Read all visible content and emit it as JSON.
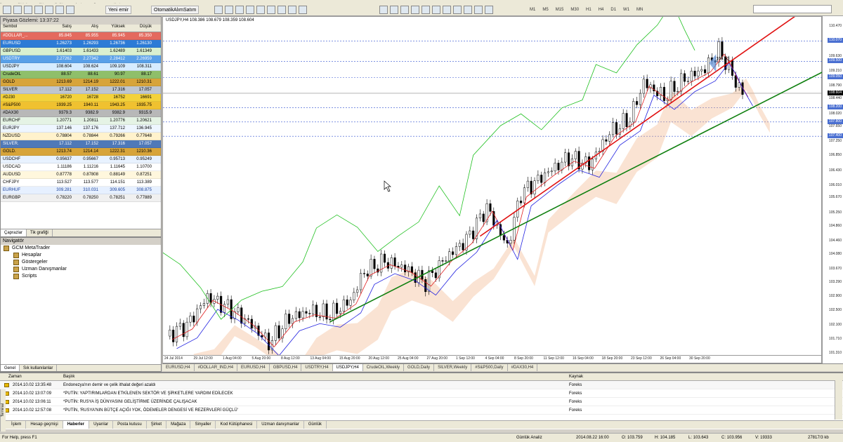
{
  "menu": [
    "Dosya",
    "Görünüm",
    "Ekle",
    "Grafikler",
    "Araçlar",
    "Pencere",
    "Yardım"
  ],
  "toolbar": {
    "new_order": "Yeni emir",
    "autotrading": "OtomatikAlımSatım",
    "timeframes": [
      "M1",
      "M5",
      "M15",
      "M30",
      "H1",
      "H4",
      "D1",
      "W1",
      "MN"
    ]
  },
  "market_watch": {
    "title": "Piyasa Gözlemi: 13:37:22",
    "headers": [
      "Sembol",
      "Satış",
      "Alış",
      "Yüksek",
      "Düşük"
    ],
    "rows": [
      {
        "s": "#DOLLAR_...",
        "bid": "85.845",
        "ask": "85.955",
        "high": "85.945",
        "low": "85.350",
        "bg": "#e46a5e",
        "fg": "#fff"
      },
      {
        "s": "EURUSD",
        "bid": "1.26273",
        "ask": "1.26293",
        "high": "1.26736",
        "low": "1.26130",
        "bg": "#2c7bd6",
        "fg": "#fff"
      },
      {
        "s": "GBPUSD",
        "bid": "1.61403",
        "ask": "1.61433",
        "high": "1.62489",
        "low": "1.61349",
        "bg": "#d9f0d0",
        "fg": "#000"
      },
      {
        "s": "USDTRY",
        "bid": "2.27262",
        "ask": "2.27342",
        "high": "2.28412",
        "low": "2.26959",
        "bg": "#59a0e8",
        "fg": "#fff"
      },
      {
        "s": "USDJPY",
        "bid": "108.604",
        "ask": "108.624",
        "high": "109.109",
        "low": "108.311",
        "bg": "#d6ecff",
        "fg": "#000"
      },
      {
        "s": "CrudeOIL",
        "bid": "88.57",
        "ask": "88.61",
        "high": "90.97",
        "low": "88.17",
        "bg": "#8fbf6a",
        "fg": "#000"
      },
      {
        "s": "GOLD",
        "bid": "1213.69",
        "ask": "1214.19",
        "high": "1222.01",
        "low": "1210.31",
        "bg": "#d7a43a",
        "fg": "#000"
      },
      {
        "s": "SILVER",
        "bid": "17.112",
        "ask": "17.152",
        "high": "17.316",
        "low": "17.057",
        "bg": "#bfc6cf",
        "fg": "#000"
      },
      {
        "s": "#DJ30",
        "bid": "16720",
        "ask": "16728",
        "high": "16752",
        "low": "16691",
        "bg": "#f3d23b",
        "fg": "#000"
      },
      {
        "s": "#S&P500",
        "bid": "1939.25",
        "ask": "1940.11",
        "high": "1943.25",
        "low": "1935.75",
        "bg": "#f0c130",
        "fg": "#000"
      },
      {
        "s": "#DAX30",
        "bid": "9379.3",
        "ask": "9382.9",
        "high": "9382.9",
        "low": "9315.9",
        "bg": "#b8b8b8",
        "fg": "#000"
      },
      {
        "s": "EURCHF",
        "bid": "1.20771",
        "ask": "1.20811",
        "high": "1.20776",
        "low": "1.20621",
        "bg": "#e5f3e5",
        "fg": "#000"
      },
      {
        "s": "EURJPY",
        "bid": "137.146",
        "ask": "137.176",
        "high": "137.712",
        "low": "136.945",
        "bg": "#eef6ff",
        "fg": "#000"
      },
      {
        "s": "NZDUSD",
        "bid": "0.78804",
        "ask": "0.78844",
        "high": "0.79266",
        "low": "0.77648",
        "bg": "#fff2cc",
        "fg": "#000"
      },
      {
        "s": "SILVER.",
        "bid": "17.112",
        "ask": "17.152",
        "high": "17.316",
        "low": "17.057",
        "bg": "#4f79b8",
        "fg": "#fff"
      },
      {
        "s": "GOLD.",
        "bid": "1213.74",
        "ask": "1214.14",
        "high": "1222.31",
        "low": "1210.36",
        "bg": "#d7a43a",
        "fg": "#000"
      },
      {
        "s": "USDCHF",
        "bid": "0.95637",
        "ask": "0.95667",
        "high": "0.95713",
        "low": "0.95249",
        "bg": "#e8f2ff",
        "fg": "#000"
      },
      {
        "s": "USDCAD",
        "bid": "1.11186",
        "ask": "1.11216",
        "high": "1.11645",
        "low": "1.10700",
        "bg": "#ffffff",
        "fg": "#000"
      },
      {
        "s": "AUDUSD",
        "bid": "0.87778",
        "ask": "0.87808",
        "high": "0.88149",
        "low": "0.87251",
        "bg": "#fff7dd",
        "fg": "#000"
      },
      {
        "s": "CHFJPY",
        "bid": "113.527",
        "ask": "113.577",
        "high": "114.151",
        "low": "113.389",
        "bg": "#ffffff",
        "fg": "#000"
      },
      {
        "s": "EURHUF",
        "bid": "309.281",
        "ask": "310.031",
        "high": "309.605",
        "low": "308.875",
        "bg": "#e6f0ff",
        "fg": "#1a3f99"
      },
      {
        "s": "EURGBP",
        "bid": "0.78220",
        "ask": "0.78250",
        "high": "0.78251",
        "low": "0.77889",
        "bg": "#f0f0f0",
        "fg": "#000"
      }
    ],
    "tabs": [
      "Çaprazlar",
      "Tik grafiği"
    ]
  },
  "navigator": {
    "title": "Navigatör",
    "root": "GCM MetaTrader",
    "items": [
      "Hesaplar",
      "Göstergeler",
      "Uzman Danışmanlar",
      "Scripts"
    ],
    "tabs": [
      "Genel",
      "Sık kullanılanlar"
    ]
  },
  "chart": {
    "label": "USDJPY,H4  108.386 108.679 108.359 108.604",
    "price_ticks": [
      "110.470",
      "109.630",
      "109.210",
      "108.790",
      "108.440",
      "108.020",
      "107.650",
      "107.250",
      "106.850",
      "106.430",
      "106.010",
      "105.670",
      "105.250",
      "104.860",
      "104.460",
      "104.080",
      "103.670",
      "103.290",
      "102.900",
      "102.500",
      "102.100",
      "101.710",
      "101.310"
    ],
    "price_tags": [
      {
        "v": "110.070",
        "bg": "#4a6fd1"
      },
      {
        "v": "109.500",
        "bg": "#4a6fd1"
      },
      {
        "v": "109.050",
        "bg": "#4a6fd1"
      },
      {
        "v": "108.604",
        "bg": "#000"
      },
      {
        "v": "108.200",
        "bg": "#4a6fd1"
      },
      {
        "v": "107.800",
        "bg": "#4a6fd1"
      },
      {
        "v": "107.400",
        "bg": "#4a6fd1"
      }
    ],
    "annotation": "109.50",
    "time_ticks": [
      "24 Jul 2014",
      "29 Jul 12:00",
      "1 Aug 04:00",
      "5 Aug 20:00",
      "8 Aug 12:00",
      "13 Aug 04:00",
      "15 Aug 20:00",
      "20 Aug 12:00",
      "25 Aug 04:00",
      "27 Aug 20:00",
      "1 Sep 12:00",
      "4 Sep 04:00",
      "8 Sep 20:00",
      "11 Sep 12:00",
      "16 Sep 04:00",
      "18 Sep 20:00",
      "23 Sep 12:00",
      "26 Sep 04:00",
      "30 Sep 20:00"
    ],
    "colors": {
      "price": "#000000",
      "tenkan": "#e02020",
      "kijun": "#2020e0",
      "chikou": "#20c020",
      "cloud": "#f0b080",
      "trend_red": "#e01010",
      "trend_green": "#108010",
      "hline": "#3050d0"
    }
  },
  "chart_tabs": [
    "EURUSD,H4",
    "#DOLLAR_IND,H4",
    "EURUSD,H4",
    "GBPUSD,H4",
    "USDTRY,H4",
    "USDJPY,H4",
    "CrudeOIL,Weekly",
    "GOLD,Daily",
    "SILVER,Weekly",
    "#S&P500,Daily",
    "#DAX30,H4"
  ],
  "chart_tab_active": 5,
  "news": {
    "headers": [
      "Zaman",
      "Başlık",
      "Kaynak"
    ],
    "rows": [
      {
        "t": "2014.10.02 13:35:48",
        "h": "Endonezya'nın demir ve çelik ithalat değeri azaldı",
        "s": "Foreks"
      },
      {
        "t": "2014.10.02 13:07:09",
        "h": "*PUTİN: YAPTIRIMLARDAN ETKİLENEN SEKTÖR VE ŞİRKETLERE YARDIM EDİLECEK",
        "s": "Foreks"
      },
      {
        "t": "2014.10.02 13:06:11",
        "h": "*PUTİN: RUSYA İŞ DÜNYASINI GELİŞTİRME ÜZERİNDE ÇALIŞACAK",
        "s": "Foreks"
      },
      {
        "t": "2014.10.02 12:57:08",
        "h": "*PUTİN, 'RUSYA'NIN BÜTÇE AÇIĞI YOK, ÖDEMELER DENGESİ VE REZERVLERİ GÜÇLÜ'",
        "s": "Foreks"
      }
    ]
  },
  "terminal_tabs": [
    "İşlem",
    "Hesap geçmişi",
    "Haberler",
    "Uyarılar",
    "Posta kutusu",
    "Şirket",
    "Mağaza",
    "Sinyaller",
    "Kod Kütüphanesi",
    "Uzman danışmanlar",
    "Günlük"
  ],
  "terminal_tab_active": 2,
  "terminal_side_label": "Terminal",
  "status": {
    "help": "For Help, press F1",
    "profile": "Günlük Analiz",
    "datetime": "2014.08.22 16:00",
    "open": "O: 103.759",
    "high": "H: 104.185",
    "low": "L: 103.643",
    "close": "C: 103.956",
    "volume": "V: 19333",
    "traffic": "27817/3 kb"
  }
}
